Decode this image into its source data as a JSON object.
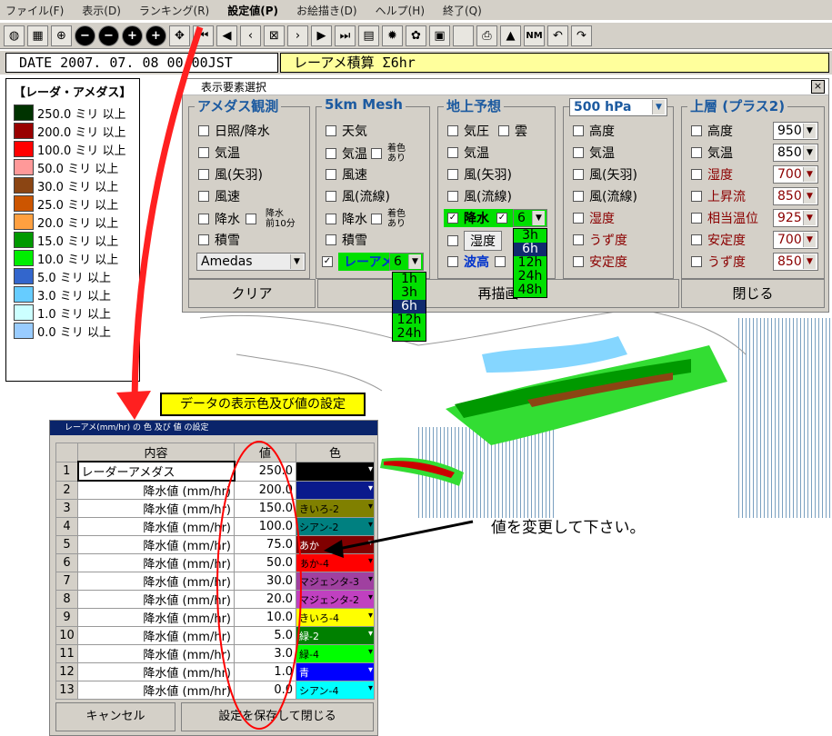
{
  "menu": [
    "ファイル(F)",
    "表示(D)",
    "ランキング(R)",
    "設定値(P)",
    "お絵描き(D)",
    "ヘルプ(H)",
    "終了(Q)"
  ],
  "date_label": "DATE 2007. 07. 08  00:00JST",
  "accum_label": "レーアメ積算 Σ6hr",
  "legend": {
    "title": "【レーダ・アメダス】",
    "entries": [
      {
        "label": "250.0 ミリ 以上",
        "color": "#003300"
      },
      {
        "label": "200.0 ミリ 以上",
        "color": "#990000"
      },
      {
        "label": "100.0 ミリ 以上",
        "color": "#ff0000"
      },
      {
        "label": "50.0 ミリ 以上",
        "color": "#ff9999"
      },
      {
        "label": "30.0 ミリ 以上",
        "color": "#8b4513"
      },
      {
        "label": "25.0 ミリ 以上",
        "color": "#cc5500"
      },
      {
        "label": "20.0 ミリ 以上",
        "color": "#ffa040"
      },
      {
        "label": "15.0 ミリ 以上",
        "color": "#009900"
      },
      {
        "label": "10.0 ミリ 以上",
        "color": "#00ee00"
      },
      {
        "label": "5.0 ミリ 以上",
        "color": "#3366cc"
      },
      {
        "label": "3.0 ミリ 以上",
        "color": "#66ccff"
      },
      {
        "label": "1.0 ミリ 以上",
        "color": "#ccffff"
      },
      {
        "label": "0.0 ミリ 以上",
        "color": "#99ccff"
      }
    ]
  },
  "display_dialog": {
    "title": "表示要素選択",
    "close": "×",
    "groups": {
      "amedas": {
        "header": "アメダス観測",
        "items": [
          "日照/降水",
          "気温",
          "風(矢羽)",
          "風速",
          "降水",
          "積雪"
        ],
        "sub_note": "降水\n前10分",
        "combo": "Amedas"
      },
      "mesh": {
        "header": "5km Mesh",
        "items": [
          "天気",
          "気温",
          "風速",
          "風(流線)",
          "降水",
          "積雪",
          "レーアメ"
        ],
        "note": "着色\nあり",
        "combo": "6",
        "dropdown": [
          "1h",
          "3h",
          "6h",
          "12h",
          "24h"
        ]
      },
      "ground": {
        "header": "地上予想",
        "items": [
          "気圧",
          "雲",
          "気温",
          "風(矢羽)",
          "風(流線)",
          "降水",
          "湿度",
          "波高"
        ],
        "combo": "6",
        "dropdown": [
          "3h",
          "6h",
          "12h",
          "24h",
          "48h"
        ]
      },
      "hpa": {
        "header": "500 hPa",
        "items": [
          "高度",
          "気温",
          "風(矢羽)",
          "風(流線)",
          "湿度",
          "うず度",
          "安定度"
        ]
      },
      "upper": {
        "header": "上層 (プラス2)",
        "items": [
          "高度",
          "気温",
          "湿度",
          "上昇流",
          "相当温位",
          "安定度",
          "うず度"
        ],
        "values": [
          "950",
          "850",
          "700",
          "850",
          "925",
          "700",
          "850"
        ]
      }
    },
    "buttons": {
      "clear": "クリア",
      "redraw": "再描画",
      "close": "閉じる"
    }
  },
  "callout_color": "データの表示色及び値の設定",
  "value_dialog": {
    "title": "レーアメ(mm/hr) の 色 及び 値 の設定",
    "headers": {
      "content": "内容",
      "value": "値",
      "color": "色"
    },
    "rows": [
      {
        "idx": "1",
        "content": "レーダーアメダス",
        "value": "250.0",
        "color_name": "",
        "color": "#000000"
      },
      {
        "idx": "2",
        "content": "降水値 (mm/hr)",
        "value": "200.0",
        "color_name": "",
        "color": "#0a1a8c"
      },
      {
        "idx": "3",
        "content": "降水値 (mm/hr)",
        "value": "150.0",
        "color_name": "きいろ-2",
        "color": "#808000"
      },
      {
        "idx": "4",
        "content": "降水値 (mm/hr)",
        "value": "100.0",
        "color_name": "シアン-2",
        "color": "#008080"
      },
      {
        "idx": "5",
        "content": "降水値 (mm/hr)",
        "value": "75.0",
        "color_name": "あか",
        "color": "#800000"
      },
      {
        "idx": "6",
        "content": "降水値 (mm/hr)",
        "value": "50.0",
        "color_name": "あか-4",
        "color": "#ff0000"
      },
      {
        "idx": "7",
        "content": "降水値 (mm/hr)",
        "value": "30.0",
        "color_name": "マジェンタ-3",
        "color": "#a040a0"
      },
      {
        "idx": "8",
        "content": "降水値 (mm/hr)",
        "value": "20.0",
        "color_name": "マジェンタ-2",
        "color": "#c040c0"
      },
      {
        "idx": "9",
        "content": "降水値 (mm/hr)",
        "value": "10.0",
        "color_name": "きいろ-4",
        "color": "#ffff00"
      },
      {
        "idx": "10",
        "content": "降水値 (mm/hr)",
        "value": "5.0",
        "color_name": "緑-2",
        "color": "#008000"
      },
      {
        "idx": "11",
        "content": "降水値 (mm/hr)",
        "value": "3.0",
        "color_name": "緑-4",
        "color": "#00ff00"
      },
      {
        "idx": "12",
        "content": "降水値 (mm/hr)",
        "value": "1.0",
        "color_name": "青",
        "color": "#0000ff"
      },
      {
        "idx": "13",
        "content": "降水値 (mm/hr)",
        "value": "0.0",
        "color_name": "シアン-4",
        "color": "#00ffff"
      }
    ],
    "buttons": {
      "cancel": "キャンセル",
      "save": "設定を保存して閉じる"
    }
  },
  "note_change": "値を変更して下さい。"
}
